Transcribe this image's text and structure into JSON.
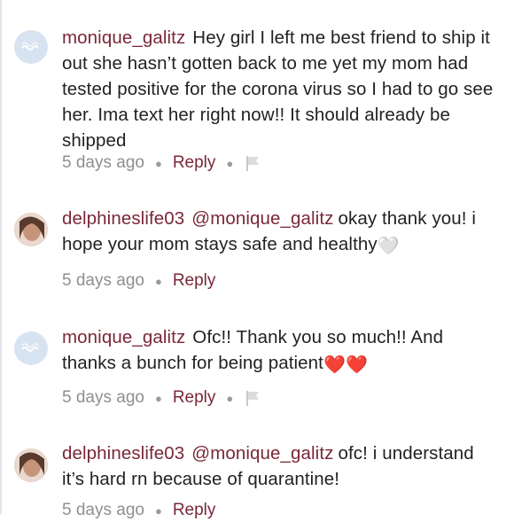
{
  "comments": [
    {
      "username": "monique_galitz",
      "mention": "",
      "text": "Hey girl I left me best friend to ship it out she hasn’t gotten back to me yet my mom had tested positive for the corona virus so I had to go see her. Ima text her right now!! It should already be shipped",
      "emoji": "",
      "time": "5 days ago",
      "reply_label": "Reply",
      "has_flag": true,
      "avatar": "wave-avatar"
    },
    {
      "username": "delphineslife03",
      "mention": "@monique_galitz",
      "text": "okay thank you! i hope your mom stays safe and healthy",
      "emoji": "🤍",
      "time": "5 days ago",
      "reply_label": "Reply",
      "has_flag": false,
      "avatar": "photo-avatar"
    },
    {
      "username": "monique_galitz",
      "mention": "",
      "text": "Ofc!! Thank you so much!! And thanks a bunch for being patient",
      "emoji": "❤️❤️",
      "time": "5 days ago",
      "reply_label": "Reply",
      "has_flag": true,
      "avatar": "wave-avatar"
    },
    {
      "username": "delphineslife03",
      "mention": "@monique_galitz",
      "text": "ofc! i understand it’s hard rn because of quarantine!",
      "emoji": "",
      "time": "5 days ago",
      "reply_label": "Reply",
      "has_flag": false,
      "avatar": "photo-avatar"
    }
  ],
  "colors": {
    "username": "#7a2738",
    "meta": "#8f8f8f",
    "text": "#222222"
  }
}
